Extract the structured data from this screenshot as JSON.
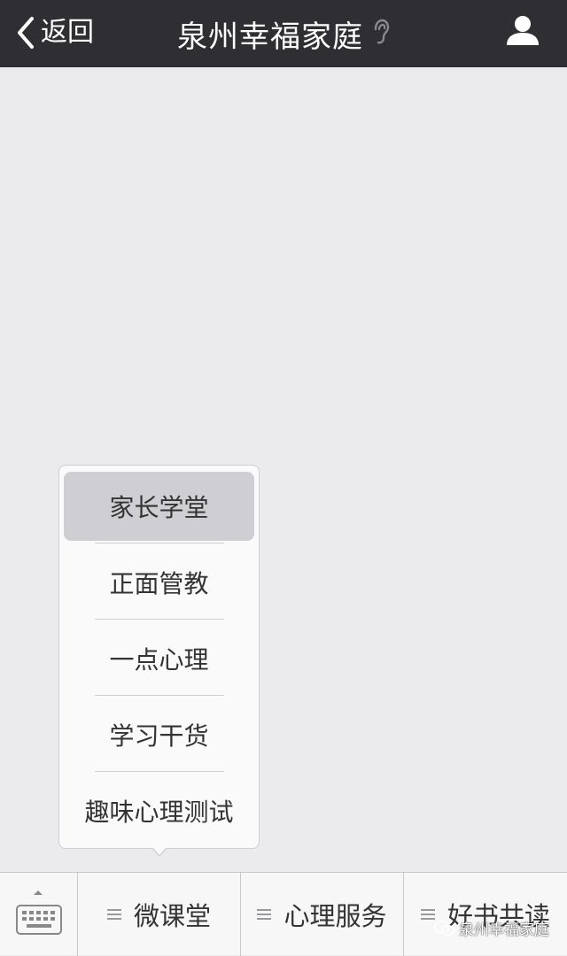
{
  "navbar": {
    "back_label": "返回",
    "title": "泉州幸福家庭",
    "title_icon": "ear-icon",
    "profile_icon": "person-icon",
    "background": "#2f2f33"
  },
  "popup_menu": {
    "items": [
      {
        "label": "家长学堂",
        "active": true
      },
      {
        "label": "正面管教",
        "active": false
      },
      {
        "label": "一点心理",
        "active": false
      },
      {
        "label": "学习干货",
        "active": false
      },
      {
        "label": "趣味心理测试",
        "active": false
      }
    ]
  },
  "bottom_bar": {
    "keyboard_icon": "keyboard-icon",
    "tabs": [
      {
        "label": "微课堂"
      },
      {
        "label": "心理服务"
      },
      {
        "label": "好书共读"
      }
    ]
  },
  "watermark": {
    "text": "泉州幸福家庭",
    "icon": "wechat-icon"
  }
}
